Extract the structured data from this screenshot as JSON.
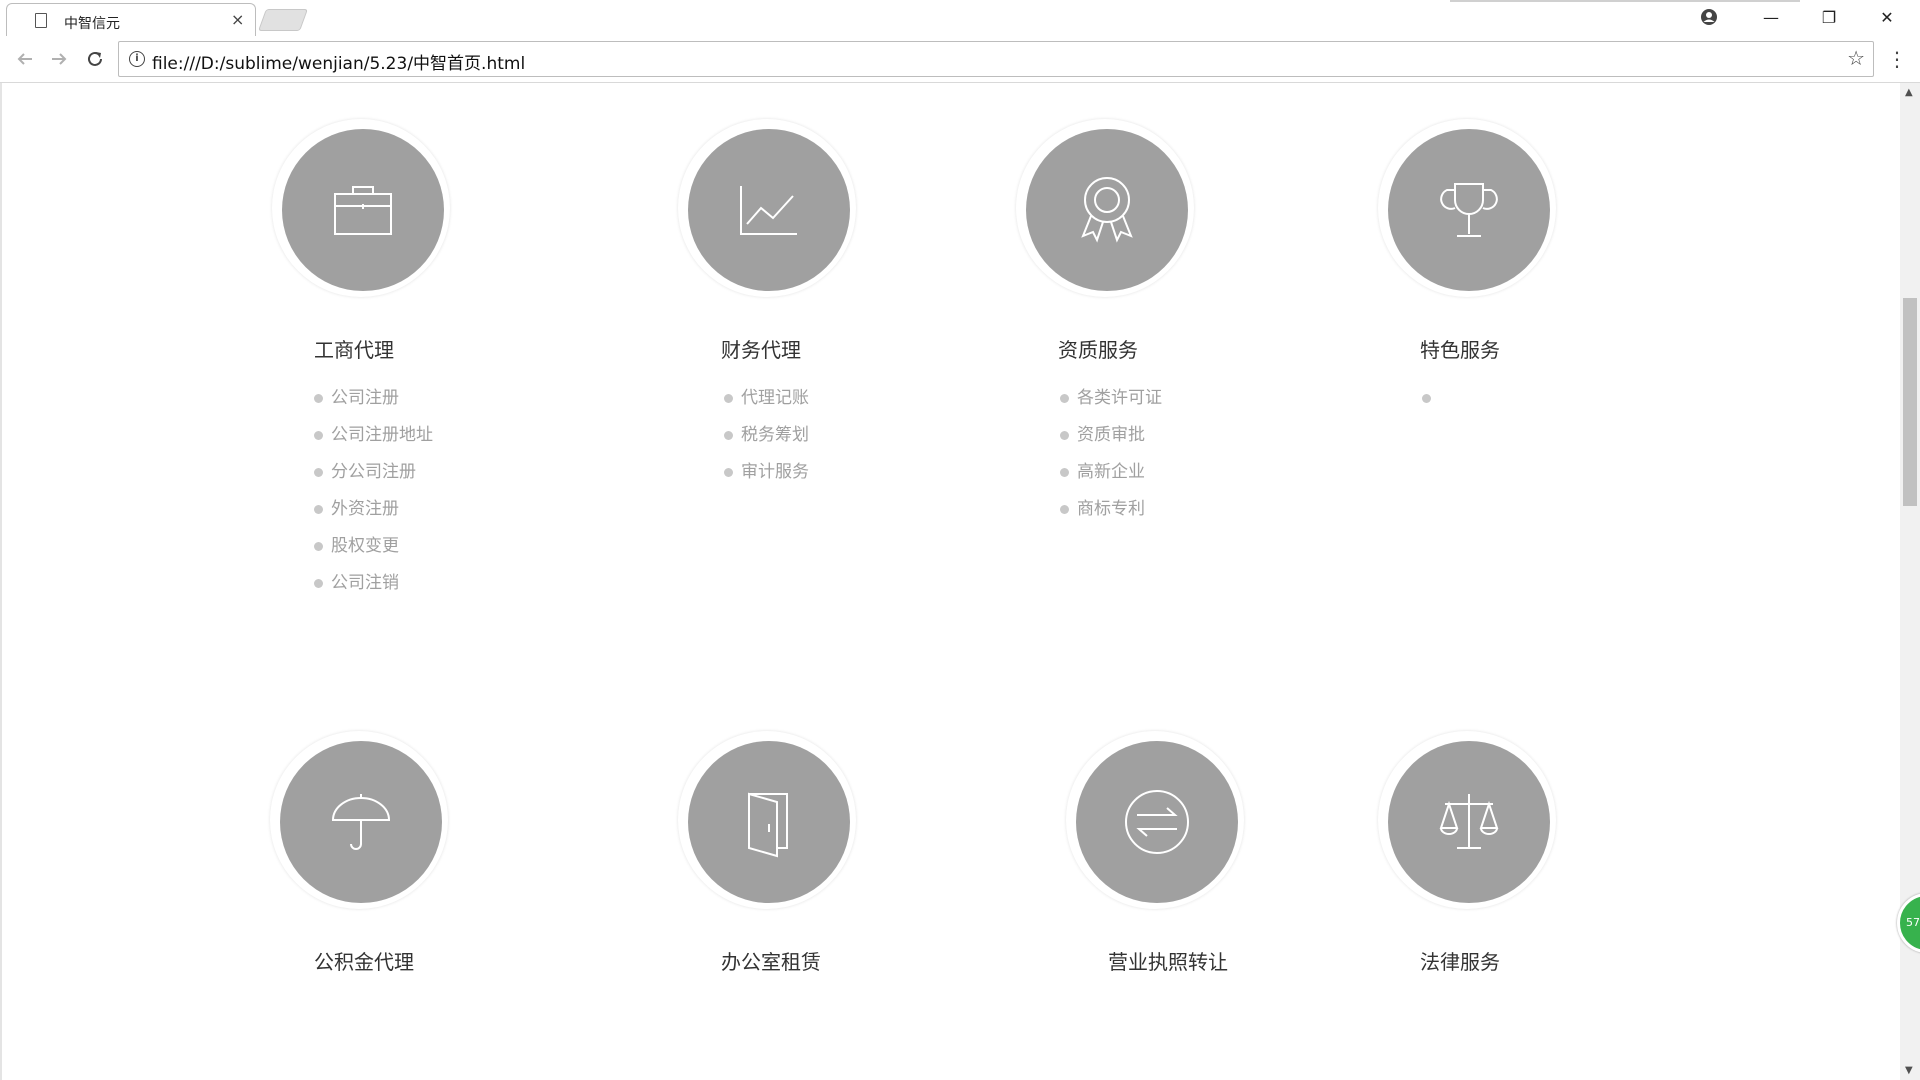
{
  "browser": {
    "tab_title": "中智信元",
    "url": "file:///D:/sublime/wenjian/5.23/中智首页.html",
    "back_icon": "back-arrow-icon",
    "forward_icon": "forward-arrow-icon",
    "reload_icon": "reload-icon",
    "minimize": "—",
    "restore": "❐",
    "close": "✕",
    "tab_close": "×",
    "star": "☆",
    "menu": "⋮"
  },
  "services": [
    {
      "title": "工商代理",
      "icon": "briefcase-icon",
      "items": [
        "公司注册",
        "公司注册地址",
        "分公司注册",
        "外资注册",
        "股权变更",
        "公司注销"
      ]
    },
    {
      "title": "财务代理",
      "icon": "line-chart-icon",
      "items": [
        "代理记账",
        "税务筹划",
        "审计服务"
      ]
    },
    {
      "title": "资质服务",
      "icon": "award-ribbon-icon",
      "items": [
        "各类许可证",
        "资质审批",
        "高新企业",
        "商标专利"
      ]
    },
    {
      "title": "特色服务",
      "icon": "trophy-icon",
      "items": [
        ""
      ]
    },
    {
      "title": "公积金代理",
      "icon": "umbrella-icon",
      "items": []
    },
    {
      "title": "办公室租赁",
      "icon": "door-icon",
      "items": []
    },
    {
      "title": "营业执照转让",
      "icon": "exchange-arrows-icon",
      "items": []
    },
    {
      "title": "法律服务",
      "icon": "scales-icon",
      "items": []
    }
  ],
  "badge": "57"
}
